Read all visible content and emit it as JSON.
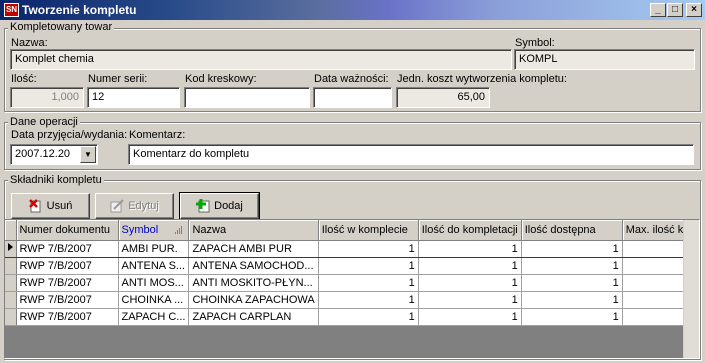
{
  "window": {
    "title": "Tworzenie kompletu",
    "app_icon_text": "SN",
    "controls": [
      "_",
      "□",
      "×"
    ]
  },
  "kompletowany": {
    "group_title": "Kompletowany towar",
    "nazwa_label": "Nazwa:",
    "nazwa_value": "Komplet chemia",
    "symbol_label": "Symbol:",
    "symbol_value": "KOMPL",
    "ilosc_label": "Ilość:",
    "ilosc_value": "1,000",
    "numer_serii_label": "Numer serii:",
    "numer_serii_value": "12",
    "kod_kreskowy_label": "Kod kreskowy:",
    "kod_kreskowy_value": "",
    "data_waznosci_label": "Data ważności:",
    "data_waznosci_value": "",
    "koszt_label": "Jedn. koszt wytworzenia kompletu:",
    "koszt_value": "65,00"
  },
  "operacja": {
    "group_title": "Dane operacji",
    "data_label": "Data przyjęcia/wydania:",
    "data_value": "2007.12.20",
    "komentarz_label": "Komentarz:",
    "komentarz_value": "Komentarz do kompletu"
  },
  "skladniki": {
    "group_title": "Składniki kompletu",
    "buttons": {
      "usun": "Usuń",
      "edytuj": "Edytuj",
      "dodaj": "Dodaj"
    },
    "columns": [
      "Numer dokumentu",
      "Symbol",
      "Nazwa",
      "Ilość w komplecie",
      "Ilość do kompletacji",
      "Ilość dostępna",
      "Max. ilość k..."
    ],
    "rows": [
      [
        "RWP 7/B/2007",
        "AMBI PUR.",
        "ZAPACH AMBI PUR",
        "1",
        "1",
        "1",
        ""
      ],
      [
        "RWP 7/B/2007",
        "ANTENA S...",
        "ANTENA SAMOCHOD...",
        "1",
        "1",
        "1",
        ""
      ],
      [
        "RWP 7/B/2007",
        "ANTI MOS...",
        "ANTI MOSKITO-PŁYN...",
        "1",
        "1",
        "1",
        ""
      ],
      [
        "RWP 7/B/2007",
        "CHOINKA ...",
        "CHOINKA ZAPACHOWA",
        "1",
        "1",
        "1",
        ""
      ],
      [
        "RWP 7/B/2007",
        "ZAPACH C...",
        "ZAPACH CARPLAN",
        "1",
        "1",
        "1",
        ""
      ]
    ],
    "selected_row": 0,
    "sorted_column": "Symbol"
  },
  "colors": {
    "sorted_header": "#0000c0",
    "selection_line": "#c00000",
    "title_start": "#0a246a"
  }
}
